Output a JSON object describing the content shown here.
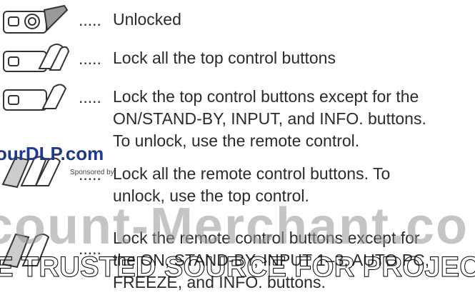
{
  "rows": [
    {
      "icon": "projector-lock-icon",
      "dots": ".....",
      "lines": [
        "Unlocked"
      ]
    },
    {
      "icon": "projector-keys-icon",
      "dots": ".....",
      "lines": [
        "Lock all the top control buttons"
      ]
    },
    {
      "icon": "projector-key-icon",
      "dots": ".....",
      "lines": [
        "Lock the top control buttons except for the",
        "ON/STAND-BY, INPUT, and INFO. buttons.",
        "To unlock, use the remote control."
      ]
    },
    {
      "icon": "remote-keys-icon",
      "dots": ".....",
      "lines": [
        "Lock all the remote control buttons. To",
        "unlock, use the top control."
      ]
    },
    {
      "icon": "remote-key-icon",
      "dots": ".....",
      "lines": [
        "Lock the remote control buttons except for",
        "the ON, STAND-BY, INPUT 1–3, AUTO PC,",
        "FREEZE, and INFO. buttons."
      ]
    }
  ],
  "watermark": {
    "site": "ourDLP.com",
    "sponsored": "Sponsored by",
    "big": "count-Merchant.co",
    "bottom": "E TRUSTED SOURCE FOR PROJECTO"
  }
}
